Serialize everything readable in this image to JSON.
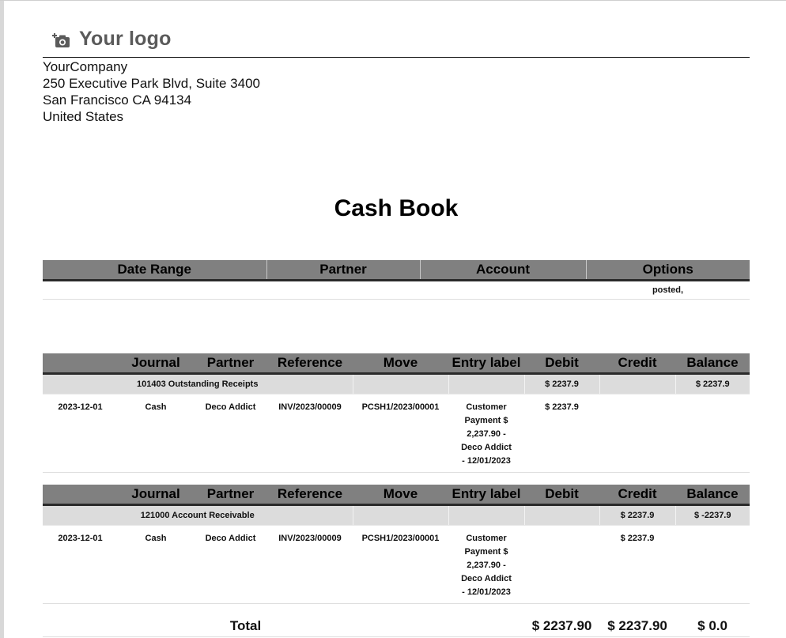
{
  "logo": {
    "text": "Your logo",
    "icon": "camera-add-icon"
  },
  "company": {
    "name": "YourCompany",
    "street": "250 Executive Park Blvd, Suite 3400",
    "city_line": "San Francisco CA 94134",
    "country": "United States"
  },
  "report": {
    "title": "Cash Book"
  },
  "filters": {
    "headers": [
      "Date Range",
      "Partner",
      "Account",
      "Options"
    ],
    "values": [
      "",
      "",
      "",
      "posted,"
    ]
  },
  "ledger_headers": [
    "",
    "Journal",
    "Partner",
    "Reference",
    "Move",
    "Entry label",
    "Debit",
    "Credit",
    "Balance"
  ],
  "accounts": [
    {
      "name": "101403 Outstanding Receipts",
      "debit": "$ 2237.9",
      "credit": "",
      "balance": "$ 2237.9",
      "lines": [
        {
          "date": "2023-12-01",
          "journal": "Cash",
          "partner": "Deco Addict",
          "reference": "INV/2023/00009",
          "move": "PCSH1/2023/00001",
          "label": "Customer Payment $ 2,237.90 - Deco Addict - 12/01/2023",
          "debit": "$ 2237.9",
          "credit": "",
          "balance": ""
        }
      ]
    },
    {
      "name": "121000 Account Receivable",
      "debit": "",
      "credit": "$ 2237.9",
      "balance": "$ -2237.9",
      "lines": [
        {
          "date": "2023-12-01",
          "journal": "Cash",
          "partner": "Deco Addict",
          "reference": "INV/2023/00009",
          "move": "PCSH1/2023/00001",
          "label": "Customer Payment $ 2,237.90 - Deco Addict - 12/01/2023",
          "debit": "",
          "credit": "$ 2237.9",
          "balance": ""
        }
      ]
    }
  ],
  "totals": {
    "label": "Total",
    "debit": "$ 2237.90",
    "credit": "$ 2237.90",
    "balance": "$ 0.0"
  }
}
